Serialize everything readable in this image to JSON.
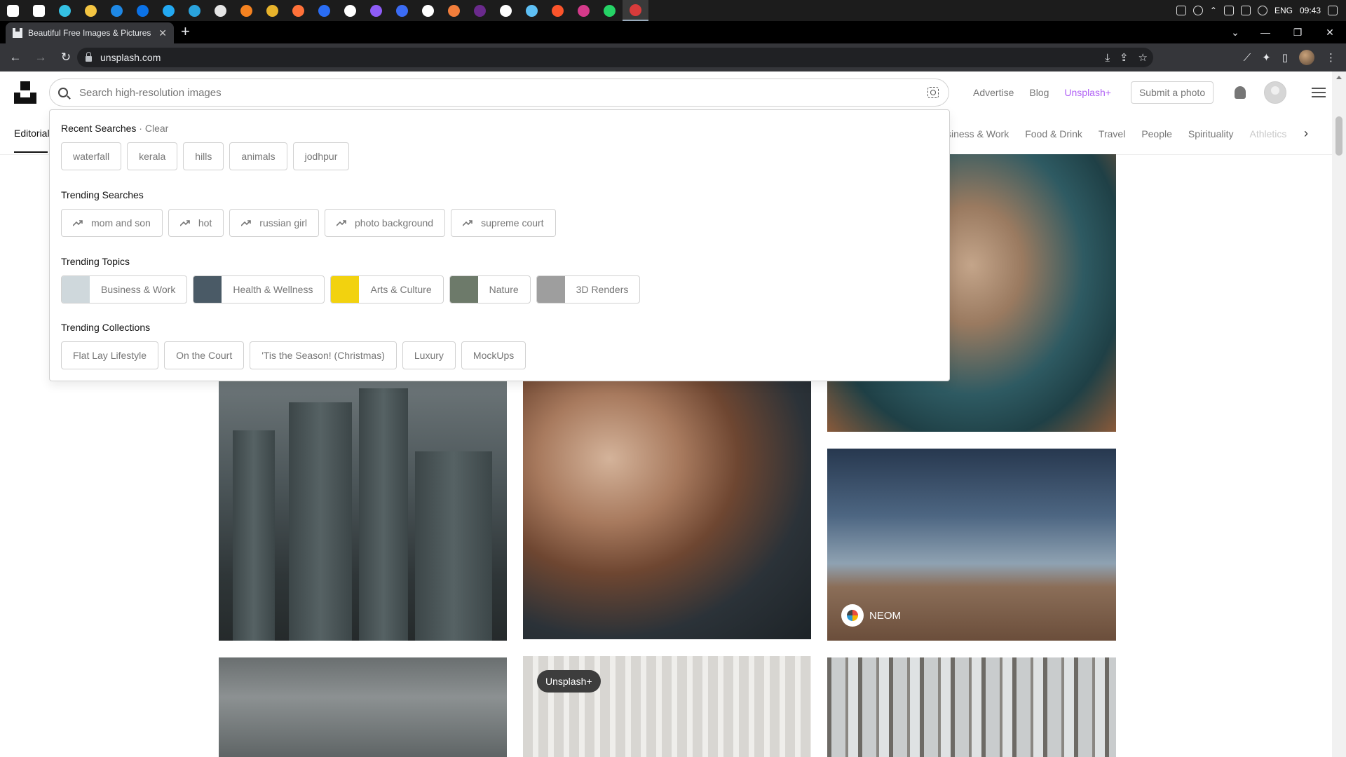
{
  "taskbar": {
    "apps": [
      {
        "name": "windows-start-icon",
        "color": "#ffffff"
      },
      {
        "name": "task-view-icon",
        "color": "#ffffff"
      },
      {
        "name": "edge-icon",
        "color": "#35c1e4"
      },
      {
        "name": "file-explorer-icon",
        "color": "#f4c542"
      },
      {
        "name": "mail-icon",
        "color": "#1e88e5"
      },
      {
        "name": "app-blue-icon",
        "color": "#0b72e7"
      },
      {
        "name": "vscode-icon",
        "color": "#23a9f2"
      },
      {
        "name": "telegram-icon",
        "color": "#2aa3dd"
      },
      {
        "name": "app-circle-icon",
        "color": "#e5e5e5"
      },
      {
        "name": "vlc-icon",
        "color": "#f58220"
      },
      {
        "name": "chrome-icon",
        "color": "#e8b32b"
      },
      {
        "name": "firefox-icon",
        "color": "#ff7139"
      },
      {
        "name": "app-m-icon",
        "color": "#2a6df4"
      },
      {
        "name": "app-ring-icon",
        "color": "#ffffff"
      },
      {
        "name": "app-purple-icon",
        "color": "#8e5cf7"
      },
      {
        "name": "app-blue-circle-icon",
        "color": "#3b6cf5"
      },
      {
        "name": "app-teal-icon",
        "color": "#ffffff"
      },
      {
        "name": "app-orange-icon",
        "color": "#f27e3b"
      },
      {
        "name": "app-violet-icon",
        "color": "#6a2a8c"
      },
      {
        "name": "app-white-circle-icon",
        "color": "#ffffff"
      },
      {
        "name": "app-chat-icon",
        "color": "#5ec0f5"
      },
      {
        "name": "brave-icon",
        "color": "#fb542b"
      },
      {
        "name": "app-multicolor-icon",
        "color": "#d43a8a"
      },
      {
        "name": "whatsapp-icon",
        "color": "#25d366"
      },
      {
        "name": "chrome-active-icon",
        "color": "#d93b3b"
      }
    ],
    "language": "ENG",
    "time": "09:43"
  },
  "browser": {
    "tab_title": "Beautiful Free Images & Pictures",
    "tab_close": "✕",
    "new_tab": "+",
    "url": "unsplash.com",
    "back": "←",
    "forward": "→",
    "reload": "↻",
    "window_controls": {
      "chevron": "⌄",
      "minimize": "—",
      "restore": "❐",
      "close": "✕"
    }
  },
  "header": {
    "search_placeholder": "Search high-resolution images",
    "links": {
      "advertise": "Advertise",
      "blog": "Blog",
      "unsplash_plus": "Unsplash+"
    },
    "submit_photo": "Submit a photo",
    "brand_color": "#b163f5"
  },
  "topics": {
    "editorial": "Editorial",
    "visible": [
      "siness & Work",
      "Food & Drink",
      "Travel",
      "People",
      "Spirituality"
    ],
    "faded": "Athletics",
    "next": "›"
  },
  "dropdown": {
    "recent": {
      "title": "Recent Searches",
      "separator": "·",
      "clear": "Clear",
      "items": [
        "waterfall",
        "kerala",
        "hills",
        "animals",
        "jodhpur"
      ]
    },
    "trending_searches": {
      "title": "Trending Searches",
      "items": [
        "mom and son",
        "hot",
        "russian girl",
        "photo background",
        "supreme court"
      ]
    },
    "trending_topics": {
      "title": "Trending Topics",
      "items": [
        {
          "label": "Business & Work",
          "thumb": "#cfd8dc"
        },
        {
          "label": "Health & Wellness",
          "thumb": "#4a5a66"
        },
        {
          "label": "Arts & Culture",
          "thumb": "#f2d20f"
        },
        {
          "label": "Nature",
          "thumb": "#6d7a6a"
        },
        {
          "label": "3D Renders",
          "thumb": "#9e9e9e"
        }
      ]
    },
    "trending_collections": {
      "title": "Trending Collections",
      "items": [
        "Flat Lay Lifestyle",
        "On the Court",
        "'Tis the Season! (Christmas)",
        "Luxury",
        "MockUps"
      ]
    }
  },
  "photos": {
    "neom_label": "NEOM",
    "plus_badge": "Unsplash+"
  }
}
